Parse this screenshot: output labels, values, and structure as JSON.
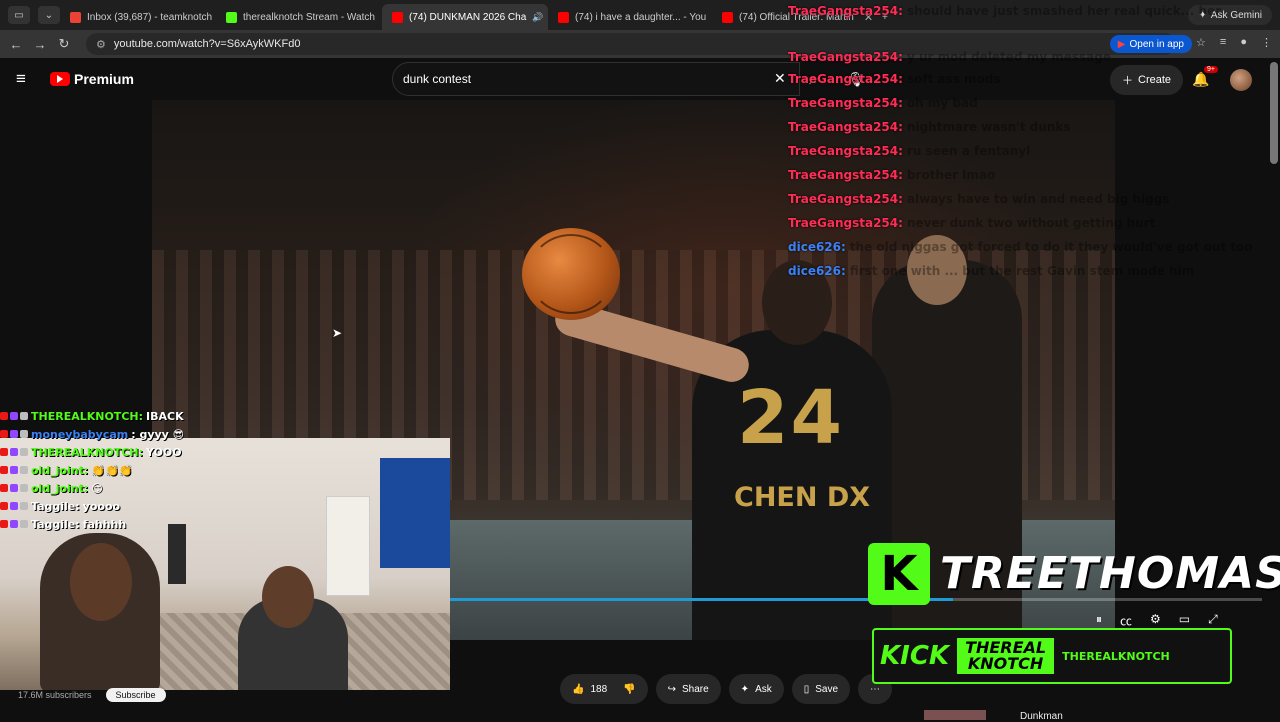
{
  "browser": {
    "tabs": [
      {
        "title": "Inbox (39,687) - teamknotch",
        "color": "#ea4335"
      },
      {
        "title": "therealknotch Stream - Watch",
        "color": "#53fc18"
      },
      {
        "title": "(74) DUNKMAN 2026 Cha",
        "color": "#ff0000"
      },
      {
        "title": "(74) i have a daughter... - You",
        "color": "#ff0000"
      },
      {
        "title": "(74) Official Trailer: Martin",
        "color": "#ff0000"
      }
    ],
    "new_tab": "+",
    "ask_gemini": "Ask Gemini",
    "url": "youtube.com/watch?v=S6xAykWKFd0",
    "open_in_app": "Open in app"
  },
  "youtube": {
    "logo_text": "Premium",
    "search_value": "dunk contest",
    "create_label": "Create",
    "notification_count": "9+",
    "subscriber_count": "17.6M subscribers",
    "subscribe_label": "Subscribe",
    "like_count": "188",
    "share_label": "Share",
    "ask_label": "Ask",
    "save_label": "Save",
    "related_title": "Dunkman"
  },
  "video": {
    "jersey_number": "24",
    "jersey_name": "CHEN DX",
    "progress": 0.62
  },
  "overlay_chat": [
    {
      "user": "TraeGangsta254:",
      "msg": "should have just smashed her real quick... her",
      "color": "#ff2d55"
    },
    {
      "user": "TraeGangsta254:",
      "msg": "y ur mod deleted my message",
      "color": "#ff2d55"
    },
    {
      "user": "TraeGangsta254:",
      "msg": "soft ass mods",
      "color": "#ff2d55"
    },
    {
      "user": "TraeGangsta254:",
      "msg": "oh my bad",
      "color": "#ff2d55"
    },
    {
      "user": "TraeGangsta254:",
      "msg": "nightmare wasn't dunks",
      "color": "#ff2d55"
    },
    {
      "user": "TraeGangsta254:",
      "msg": "ru seen a fentanyl",
      "color": "#ff2d55"
    },
    {
      "user": "TraeGangsta254:",
      "msg": "brother lmao",
      "color": "#ff2d55"
    },
    {
      "user": "TraeGangsta254:",
      "msg": "always have to win and need big higgs",
      "color": "#ff2d55"
    },
    {
      "user": "TraeGangsta254:",
      "msg": "never dunk two without getting hurt",
      "color": "#ff2d55"
    },
    {
      "user": "dice626:",
      "msg": "the old niggas got forced to do it they would've got out too",
      "color": "#3b82f6"
    },
    {
      "user": "dice626:",
      "msg": "first one with ... but the rest Gavin stem mode him",
      "color": "#3b82f6"
    }
  ],
  "stream_chat": [
    {
      "user": "THEREALKNOTCH:",
      "msg": "IBACK",
      "color": "#53fc18"
    },
    {
      "user": "moneybabycam",
      "msg": ": gyyy 😎",
      "color": "#3b82f6"
    },
    {
      "user": "THEREALKNOTCH:",
      "msg": "YOOO",
      "color": "#53fc18"
    },
    {
      "user": "old_joint:",
      "msg": "👏👏👏",
      "color": "#53fc18"
    },
    {
      "user": "old_joint:",
      "msg": "😏",
      "color": "#53fc18"
    },
    {
      "user": "Taggile:",
      "msg": "yoooo",
      "color": "#ffffff"
    },
    {
      "user": "Taggile:",
      "msg": "fahhhh",
      "color": "#ffffff"
    }
  ],
  "kick": {
    "streamer_name": "TREETHOMASX",
    "brand": "KICK",
    "banner_name_line1": "THEREAL",
    "banner_name_line2": "KNOTCH",
    "banner_handle": "THEREALKNOTCH",
    "accent": "#53fc18"
  }
}
